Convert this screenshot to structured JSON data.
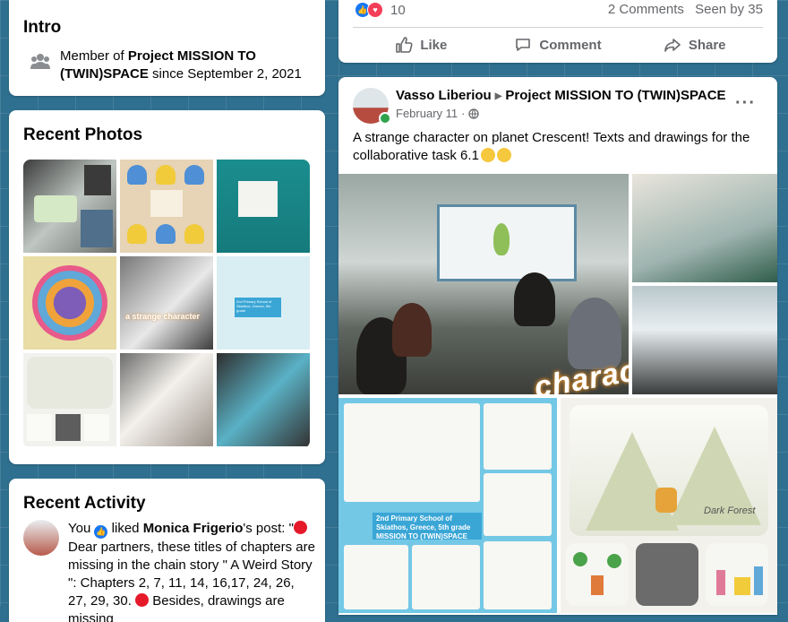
{
  "intro": {
    "title": "Intro",
    "member_prefix": "Member of ",
    "member_group": "Project MISSION TO (TWIN)SPACE",
    "member_suffix": " since September 2, 2021"
  },
  "recent_photos": {
    "title": "Recent Photos",
    "photo_captions": [
      "a strange character",
      "2nd Primary School of Skiathos, Greece, 5th grade"
    ]
  },
  "recent_activity": {
    "title": "Recent Activity",
    "subject": "You",
    "liked": "liked",
    "author": "Monica Frigerio",
    "post_prefix": "'s post: \"",
    "post_text": "Dear partners, these titles of chapters are missing in the chain story \" A Weird Story \": Chapters 2, 7, 11, 14, 16,17, 24, 26, 27, 29, 30.",
    "post_text_2": "Besides, drawings are missing"
  },
  "post1": {
    "reaction_count": "10",
    "comments": "2 Comments",
    "seen": "Seen by 35",
    "like_label": "Like",
    "comment_label": "Comment",
    "share_label": "Share"
  },
  "post2": {
    "author": "Vasso Liberiou",
    "group": "Project MISSION TO (TWIN)SPACE",
    "date": "February 11",
    "text": "A strange character on planet Crescent! Texts and drawings for the collaborative task 6.1",
    "overlay_text": "character",
    "banner_text": "2nd Primary School of Skiathos, Greece, 5th grade MISSION TO (TWIN)SPACE",
    "drawing_caption": "Dark Forest"
  },
  "colors": {
    "accent": "#1877f2",
    "love": "#f33e58",
    "online": "#31a24c",
    "background": "#2f6f8f"
  }
}
